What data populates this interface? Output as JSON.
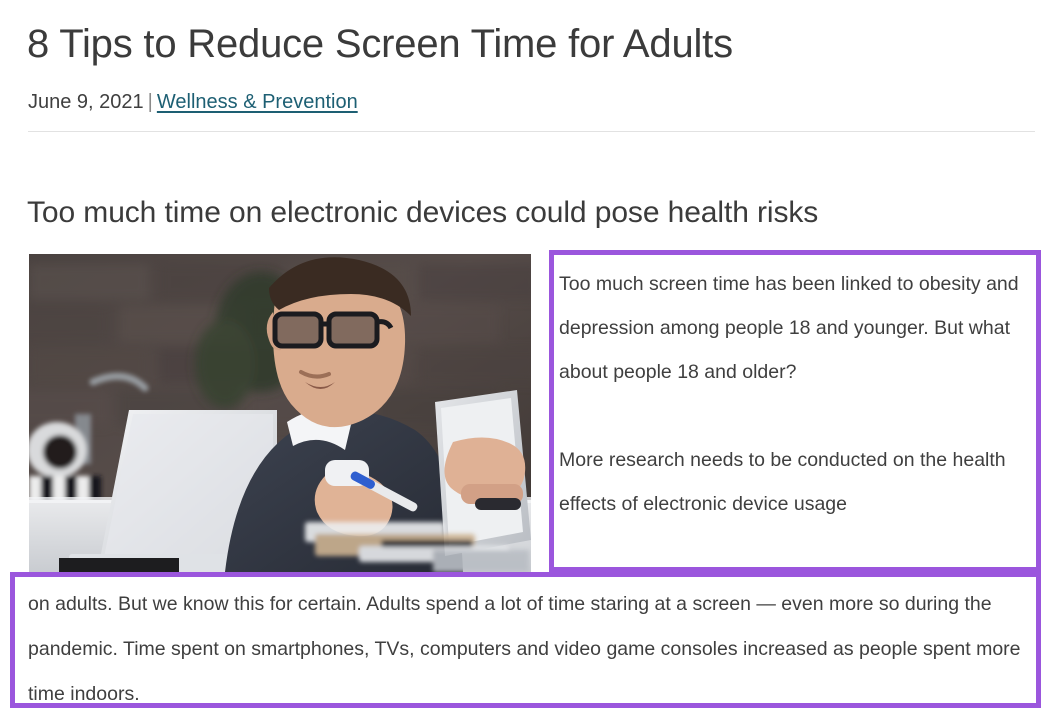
{
  "article": {
    "title": "8 Tips to Reduce Screen Time for Adults",
    "date": "June 9, 2021",
    "meta_separator": "|",
    "category_link": "Wellness & Prevention",
    "subheading": "Too much time on electronic devices could pose health risks"
  },
  "photo": {
    "alt": "Man wearing glasses sitting at a desk working on a laptop while holding a tablet and a pen"
  },
  "highlight": {
    "border_color": "#9b56dd"
  },
  "body": {
    "right_paragraph_1": "Too much screen time has been linked to obesity and depression among people 18 and younger. But what about people 18 and older?",
    "right_paragraph_2": "More research needs to be conducted on the health effects of electronic device usage",
    "bottom_paragraph": "on adults. But we know this for certain. Adults spend a lot of time staring at a screen — even more so during the pandemic. Time spent on smartphones, TVs, computers and video game consoles increased as people spent more time indoors."
  },
  "colors": {
    "title": "#3b3b3b",
    "link": "#1d5f73",
    "text": "#3f3f3f",
    "divider": "#e2e2e2",
    "highlight_purple": "#9b56dd"
  }
}
